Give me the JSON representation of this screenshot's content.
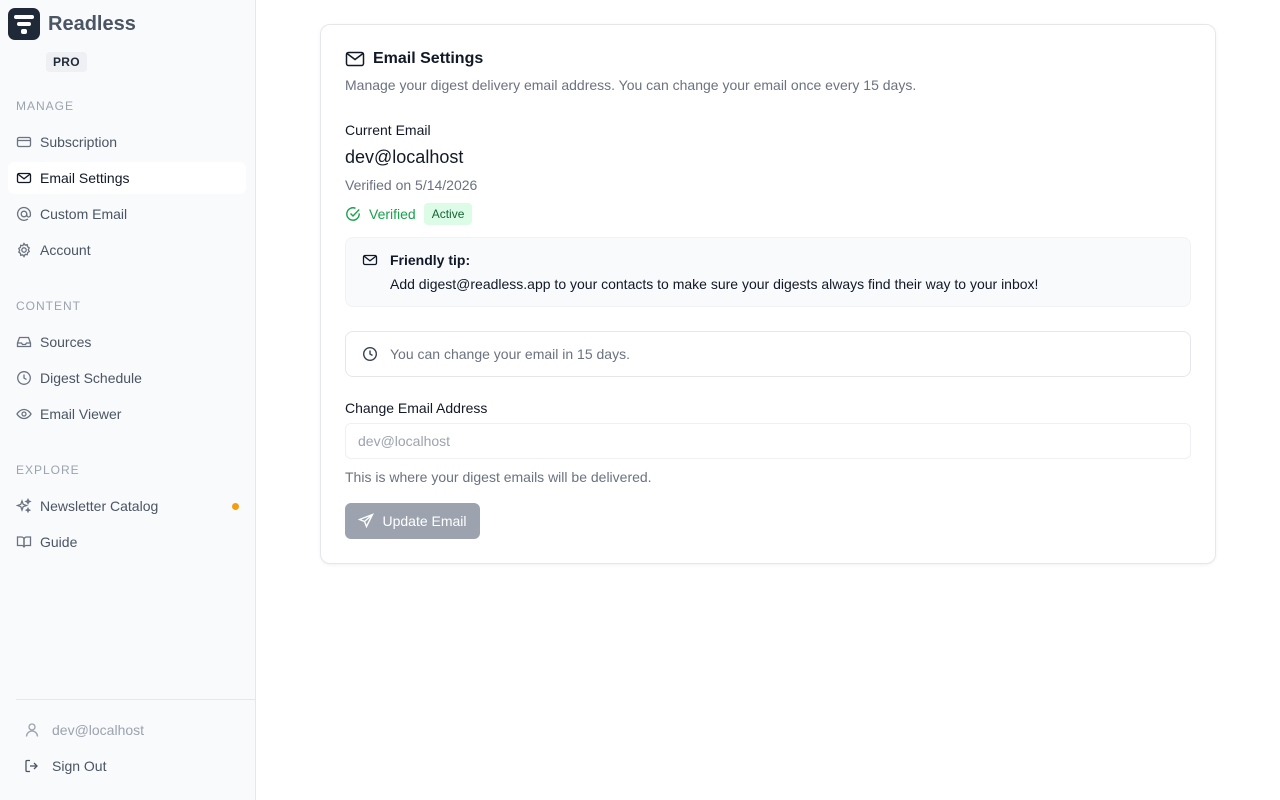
{
  "app": {
    "name": "Readless",
    "plan_badge": "PRO"
  },
  "sidebar": {
    "sections": [
      {
        "label": "MANAGE",
        "items": [
          {
            "label": "Subscription",
            "icon": "credit-card-icon"
          },
          {
            "label": "Email Settings",
            "icon": "mail-icon",
            "active": true
          },
          {
            "label": "Custom Email",
            "icon": "at-sign-icon"
          },
          {
            "label": "Account",
            "icon": "gear-icon"
          }
        ]
      },
      {
        "label": "CONTENT",
        "items": [
          {
            "label": "Sources",
            "icon": "inbox-icon"
          },
          {
            "label": "Digest Schedule",
            "icon": "clock-icon"
          },
          {
            "label": "Email Viewer",
            "icon": "eye-icon"
          }
        ]
      },
      {
        "label": "EXPLORE",
        "items": [
          {
            "label": "Newsletter Catalog",
            "icon": "sparkles-icon",
            "indicator": true
          },
          {
            "label": "Guide",
            "icon": "book-icon"
          }
        ]
      }
    ],
    "user_email": "dev@localhost",
    "sign_out_label": "Sign Out"
  },
  "email_settings": {
    "title": "Email Settings",
    "description": "Manage your digest delivery email address. You can change your email once every 15 days.",
    "current_email_label": "Current Email",
    "current_email": "dev@localhost",
    "verified_on": "Verified on 5/14/2026",
    "verified_label": "Verified",
    "status_badge": "Active",
    "tip_title": "Friendly tip:",
    "tip_body": "Add digest@readless.app to your contacts to make sure your digests always find their way to your inbox!",
    "cooldown_notice": "You can change your email in 15 days.",
    "change_label": "Change Email Address",
    "input_placeholder": "dev@localhost",
    "helper_text": "This is where your digest emails will be delivered.",
    "update_button": "Update Email"
  },
  "colors": {
    "accent_disabled": "#9ca3af",
    "success": "#16a34a",
    "badge_bg": "#dcfce7",
    "indicator": "#f59e0b"
  }
}
